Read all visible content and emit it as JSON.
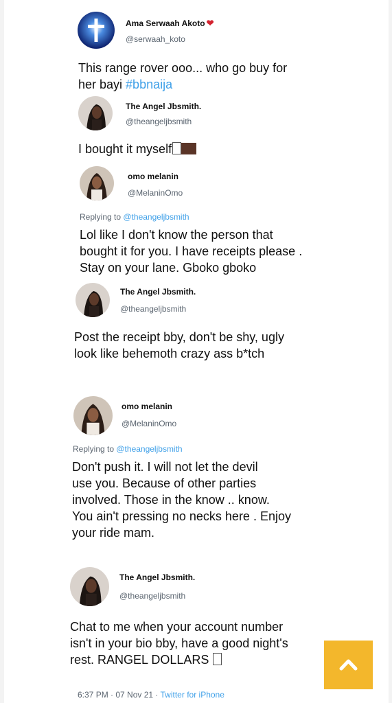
{
  "tweets": [
    {
      "name": "Ama Serwaah Akoto",
      "name_suffix": "❤",
      "handle": "@serwaah_koto",
      "lines": [
        "This range rover ooo... who go buy for"
      ],
      "line2_prefix": "her bayi ",
      "hashtag": "#bbnaija"
    },
    {
      "name": "The Angel Jbsmith.",
      "handle": "@theangeljbsmith",
      "lines": [
        "I bought it myself"
      ]
    },
    {
      "name": "omo melanin",
      "handle": "@MelaninOmo",
      "replying_label": "Replying to ",
      "replying_to": "@theangeljbsmith",
      "lines": [
        "Lol like I don't know the person  that",
        "bought it for you. I have receipts please .",
        "Stay on your lane. Gboko gboko"
      ]
    },
    {
      "name": "The Angel Jbsmith.",
      "handle": "@theangeljbsmith",
      "lines": [
        "Post the receipt bby, don't be shy, ugly",
        "look like behemoth crazy ass b*tch"
      ]
    },
    {
      "name": "omo melanin",
      "handle": "@MelaninOmo",
      "replying_label": "Replying to ",
      "replying_to": "@theangeljbsmith",
      "lines": [
        "Don't push it. I  will not let the devil",
        "use you. Because of other parties",
        "involved. Those in the know .. know.",
        "You ain't pressing no necks  here . Enjoy",
        "your ride mam."
      ]
    },
    {
      "name": "The Angel Jbsmith.",
      "handle": "@theangeljbsmith",
      "lines": [
        "Chat to me when your account number",
        "isn't in your bio bby, have a good night's",
        "rest. RANGEL DOLLARS"
      ]
    }
  ],
  "footer": {
    "time": "6:37 PM · 07 Nov 21 · ",
    "source": "Twitter for iPhone"
  },
  "icons": {
    "avatar_1": "glowing-cross-avatar",
    "scroll_top": "chevron-up-icon"
  },
  "colors": {
    "link": "#3fa0e8",
    "scroll_button": "#f3b72c",
    "heart": "#d3232f"
  }
}
